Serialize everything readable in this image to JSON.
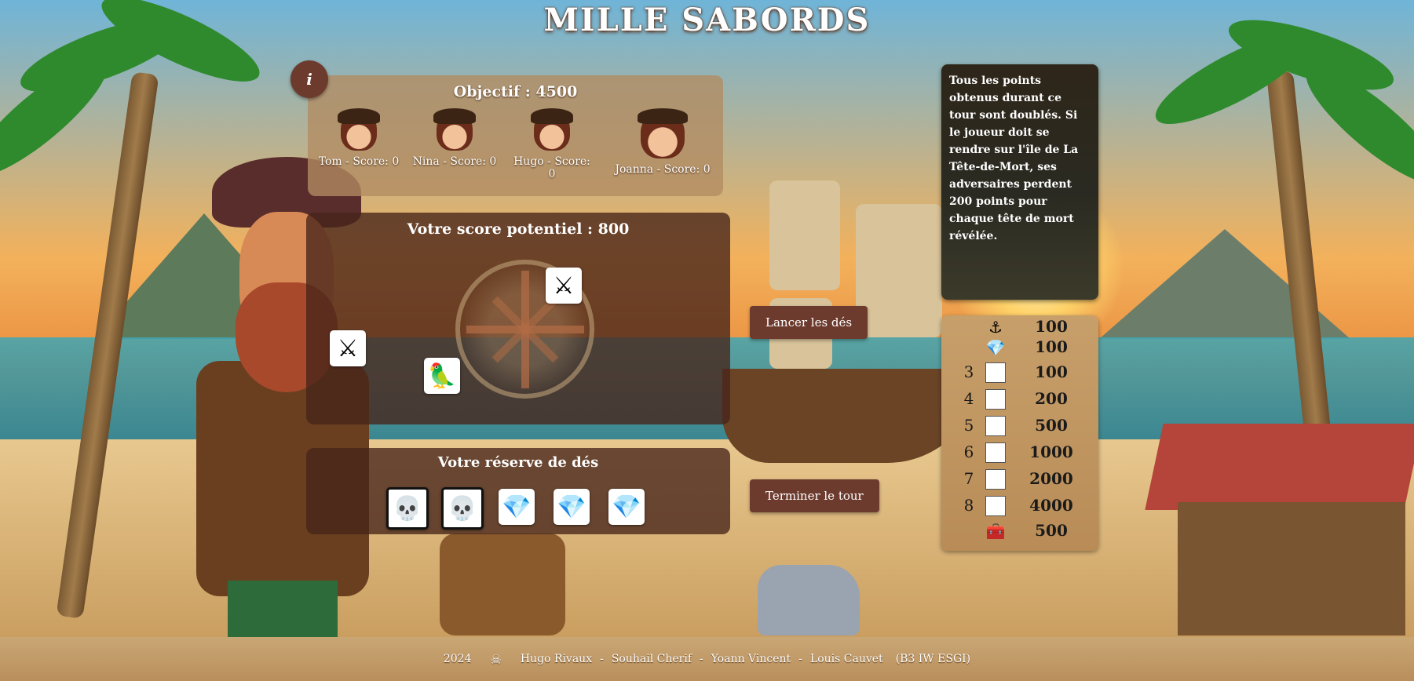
{
  "title": "MILLE SABORDS",
  "info_button": "i",
  "objective": {
    "label": "Objectif : 4500",
    "players": [
      {
        "name": "Tom - Score: 0"
      },
      {
        "name": "Nina - Score: 0"
      },
      {
        "name": "Hugo - Score: 0"
      },
      {
        "name": "Joanna - Score: 0"
      }
    ]
  },
  "potential": {
    "label": "Votre score potentiel : 800",
    "dice": [
      {
        "face": "swords",
        "glyph": "⚔"
      },
      {
        "face": "swords",
        "glyph": "⚔"
      },
      {
        "face": "parrot",
        "glyph": "🦜"
      }
    ]
  },
  "reserve": {
    "label": "Votre réserve de dés",
    "dice": [
      {
        "face": "skull",
        "glyph": "💀",
        "locked": true
      },
      {
        "face": "skull",
        "glyph": "💀",
        "locked": true
      },
      {
        "face": "diamond",
        "glyph": "💎",
        "locked": false
      },
      {
        "face": "diamond",
        "glyph": "💎",
        "locked": false
      },
      {
        "face": "diamond",
        "glyph": "💎",
        "locked": false
      }
    ]
  },
  "buttons": {
    "roll": "Lancer les dés",
    "end_turn": "Terminer le tour"
  },
  "card": {
    "text": "Tous les points obtenus durant ce tour sont doublés. Si le joueur doit se rendre sur l'île de La Tête-de-Mort, ses adversaires perdent 200 points pour chaque tête de mort révélée."
  },
  "score_table": [
    {
      "count": "",
      "icon": "coin-icon",
      "glyph": "⚓",
      "points": "100"
    },
    {
      "count": "",
      "icon": "diamond-icon",
      "glyph": "💎",
      "points": "100"
    },
    {
      "count": "3",
      "icon": "cube-icon",
      "glyph": "",
      "points": "100"
    },
    {
      "count": "4",
      "icon": "cube-icon",
      "glyph": "",
      "points": "200"
    },
    {
      "count": "5",
      "icon": "cube-icon",
      "glyph": "",
      "points": "500"
    },
    {
      "count": "6",
      "icon": "cube-icon",
      "glyph": "",
      "points": "1000"
    },
    {
      "count": "7",
      "icon": "cube-icon",
      "glyph": "",
      "points": "2000"
    },
    {
      "count": "8",
      "icon": "cube-icon",
      "glyph": "",
      "points": "4000"
    },
    {
      "count": "",
      "icon": "treasure-chest-icon",
      "glyph": "🧰",
      "points": "500"
    }
  ],
  "footer": {
    "year": "2024",
    "authors": [
      "Hugo Rivaux",
      "Souhail Cherif",
      "Yoann Vincent",
      "Louis Cauvet"
    ],
    "separator": "-",
    "class": "(B3 IW ESGI)"
  }
}
